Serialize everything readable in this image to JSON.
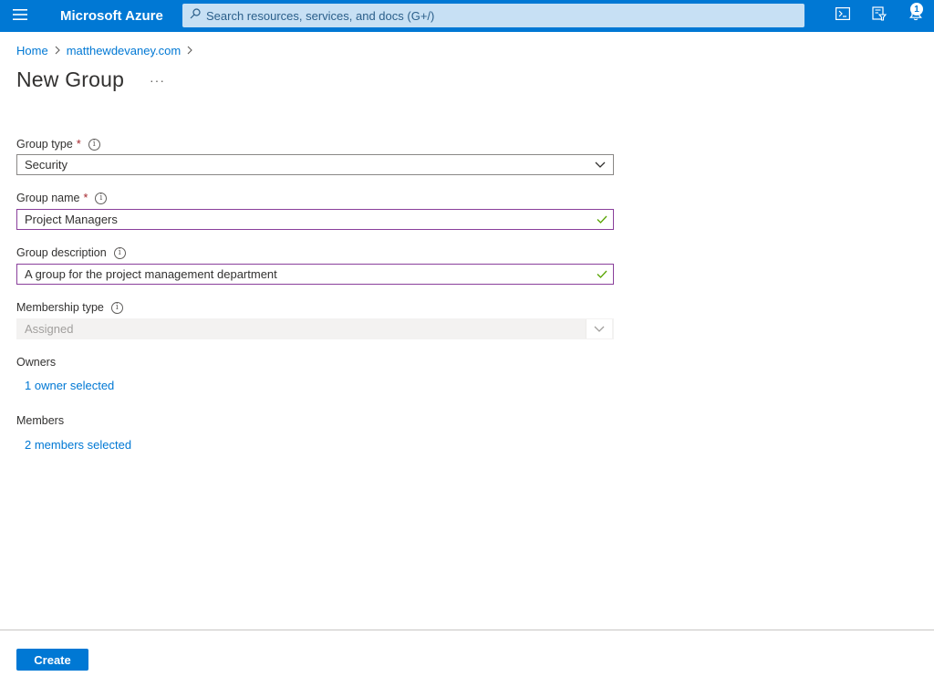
{
  "header": {
    "brand": "Microsoft Azure",
    "search_placeholder": "Search resources, services, and docs (G+/)",
    "notification_count": "1",
    "icons": [
      "menu-icon",
      "search-icon",
      "cloud-shell-icon",
      "directory-filter-icon",
      "bell-icon"
    ]
  },
  "breadcrumb": {
    "items": [
      "Home",
      "matthewdevaney.com"
    ]
  },
  "page": {
    "title": "New Group",
    "more": "···"
  },
  "form": {
    "group_type": {
      "label": "Group type",
      "required": "*",
      "value": "Security"
    },
    "group_name": {
      "label": "Group name",
      "required": "*",
      "value": "Project Managers"
    },
    "group_description": {
      "label": "Group description",
      "value": "A group for the project management department"
    },
    "membership_type": {
      "label": "Membership type",
      "value": "Assigned"
    },
    "owners": {
      "label": "Owners",
      "link": "1 owner selected"
    },
    "members": {
      "label": "Members",
      "link": "2 members selected"
    }
  },
  "footer": {
    "create_label": "Create"
  },
  "colors": {
    "brand_blue": "#0078d4",
    "valid_border": "#8a3f9b",
    "check_green": "#57a300",
    "required_red": "#a4262c"
  }
}
